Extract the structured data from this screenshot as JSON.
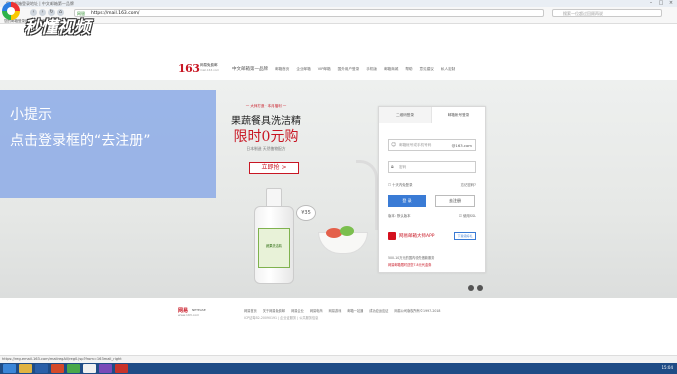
{
  "browser": {
    "tab_title": "您的邮箱登录地址 | 中文邮箱第一品牌",
    "secure_label": "网银",
    "url": "https://mail.163.com/",
    "search_placeholder": "搜索一位超过回顾再说",
    "bookmark_text": "您的邮箱登录地址 | 中文邮箱"
  },
  "watermark": "秒懂视频",
  "header": {
    "brand_number": "163",
    "brand_cn": "网易免费邮",
    "brand_en": "mail.163.com",
    "slogan": "中文邮箱第一品牌",
    "nav_items": [
      "邮箱首页",
      "企业邮箱",
      "VIP邮箱",
      "国外用户登录",
      "手机版",
      "邮箱商城",
      "帮助",
      "意见建议",
      "私人定制"
    ]
  },
  "tip": {
    "title": "小提示",
    "body": "点击登录框的“去注册”"
  },
  "promo": {
    "subtitle": "一 大师打造 · 本月福利 一",
    "line1": "果蔬餐具洗洁精",
    "line2": "限时0元购",
    "line3": "日本制造  天然植物配方",
    "button": "立即抢 >",
    "price": "¥35",
    "bottle_label": "蔬果洗洁精"
  },
  "login": {
    "tab_qr": "二维码登录",
    "tab_account": "邮箱帐号登录",
    "email_placeholder": "邮箱帐号或手机号码",
    "email_suffix": "@163.com",
    "password_placeholder": "密码",
    "remember": "十天内免登录",
    "forgot": "忘记密码?",
    "login_button": "登  录",
    "register_button": "去注册",
    "version_label": "版本: 默认版本",
    "ssl_label": "使用SSL",
    "app_text": "网易邮箱大师APP",
    "app_download": "下载领好礼",
    "note1": "500-10万元的国内领先借款服务",
    "note2": "网易邮箱限时送您7.8元代金券"
  },
  "footer": {
    "logo": "网易",
    "logo_sub": "NETEASE",
    "logo_url": "www.163.com",
    "links": [
      "网易首页",
      "关于网易免费邮",
      "网易企业",
      "网易电商",
      "网易游戏",
      "邮箱一站通",
      "成功应运应证",
      "网易公司版权所有©1997-2018"
    ],
    "links2": "ICP证粤B2-20090191  |  企业证服务  |  公共服务信息"
  },
  "status_text": "https://reg.email.163.com/mailregAll/reg0.jsp?from=163mail_right",
  "tray_time": "15:04",
  "colors": {
    "tip_bg": "#8caae6",
    "brand_red": "#c81623",
    "primary_blue": "#3a7bd5",
    "taskbar": "#1f4c86"
  },
  "taskbar_icons": [
    "ie-icon",
    "folder-icon",
    "photoshop-icon",
    "office-icon",
    "media-icon",
    "browser-icon",
    "chat-icon",
    "video-icon"
  ]
}
